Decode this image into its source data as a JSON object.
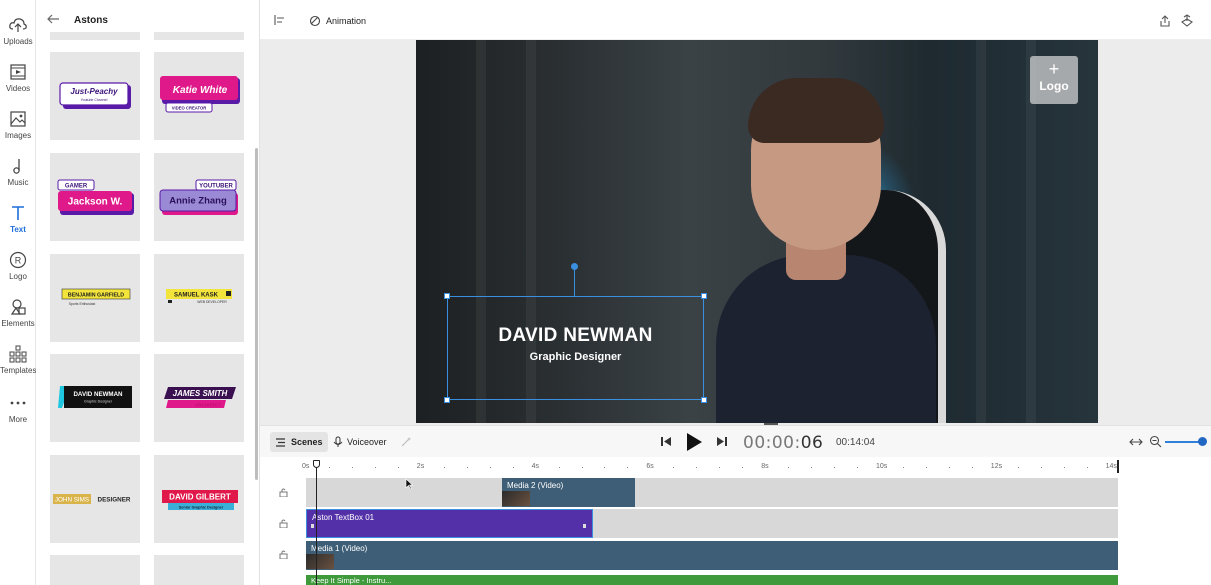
{
  "rail": {
    "items": [
      {
        "label": "Uploads",
        "icon": "upload-cloud-icon"
      },
      {
        "label": "Videos",
        "icon": "video-icon"
      },
      {
        "label": "Images",
        "icon": "image-icon"
      },
      {
        "label": "Music",
        "icon": "music-note-icon"
      },
      {
        "label": "Text",
        "icon": "text-t-icon"
      },
      {
        "label": "Logo",
        "icon": "registered-logo-icon"
      },
      {
        "label": "Elements",
        "icon": "shapes-icon"
      },
      {
        "label": "Templates",
        "icon": "templates-grid-icon"
      },
      {
        "label": "More",
        "icon": "more-dots-icon"
      }
    ],
    "active": "Text"
  },
  "panel": {
    "title": "Astons",
    "tiles": [
      {
        "line1": "Just-Peachy",
        "line2": "Youtube Channel"
      },
      {
        "line1": "Katie White",
        "line2": "VIDEO CREATOR"
      },
      {
        "line1": "GAMER",
        "line2": "Jackson W."
      },
      {
        "line1": "YOUTUBER",
        "line2": "Annie Zhang"
      },
      {
        "line1": "BENJAMIN GARFIELD",
        "line2": "Sports Enthusiast"
      },
      {
        "line1": "SAMUEL KASK",
        "line2": "WEB DEVELOPER"
      },
      {
        "line1": "DAVID NEWMAN",
        "line2": "Graphic Designer"
      },
      {
        "line1": "JAMES SMITH",
        "line2": "ARCHITECT"
      },
      {
        "line1": "JOHN SIMS",
        "line2": "DESIGNER"
      },
      {
        "line1": "DAVID GILBERT",
        "line2": "Senior Graphic Designer"
      }
    ]
  },
  "toolbar": {
    "animation_label": "Animation"
  },
  "canvas": {
    "logo_placeholder": {
      "plus": "+",
      "label": "Logo"
    },
    "aston": {
      "name": "DAVID NEWMAN",
      "role": "Graphic Designer"
    }
  },
  "transport": {
    "scenes_label": "Scenes",
    "voiceover_label": "Voiceover",
    "current_time_dim": "00:00:",
    "current_time_sec": "06",
    "total_time": "00:14:04",
    "zoom_level": 1.0
  },
  "timeline": {
    "ruler": [
      "0s",
      "2s",
      "4s",
      "6s",
      "8s",
      "10s",
      "12s",
      "14s"
    ],
    "tracks": [
      {
        "clip": "Media 2 (Video)"
      },
      {
        "clip": "Aston TextBox 01"
      },
      {
        "clip": "Media 1 (Video)"
      },
      {
        "clip": "Keep It Simple - Instru..."
      }
    ]
  },
  "colors": {
    "accent": "#3b8fe0",
    "aston_clip": "#5330a8",
    "video_clip": "#3d5e76",
    "audio_clip": "#3f9a3c"
  }
}
